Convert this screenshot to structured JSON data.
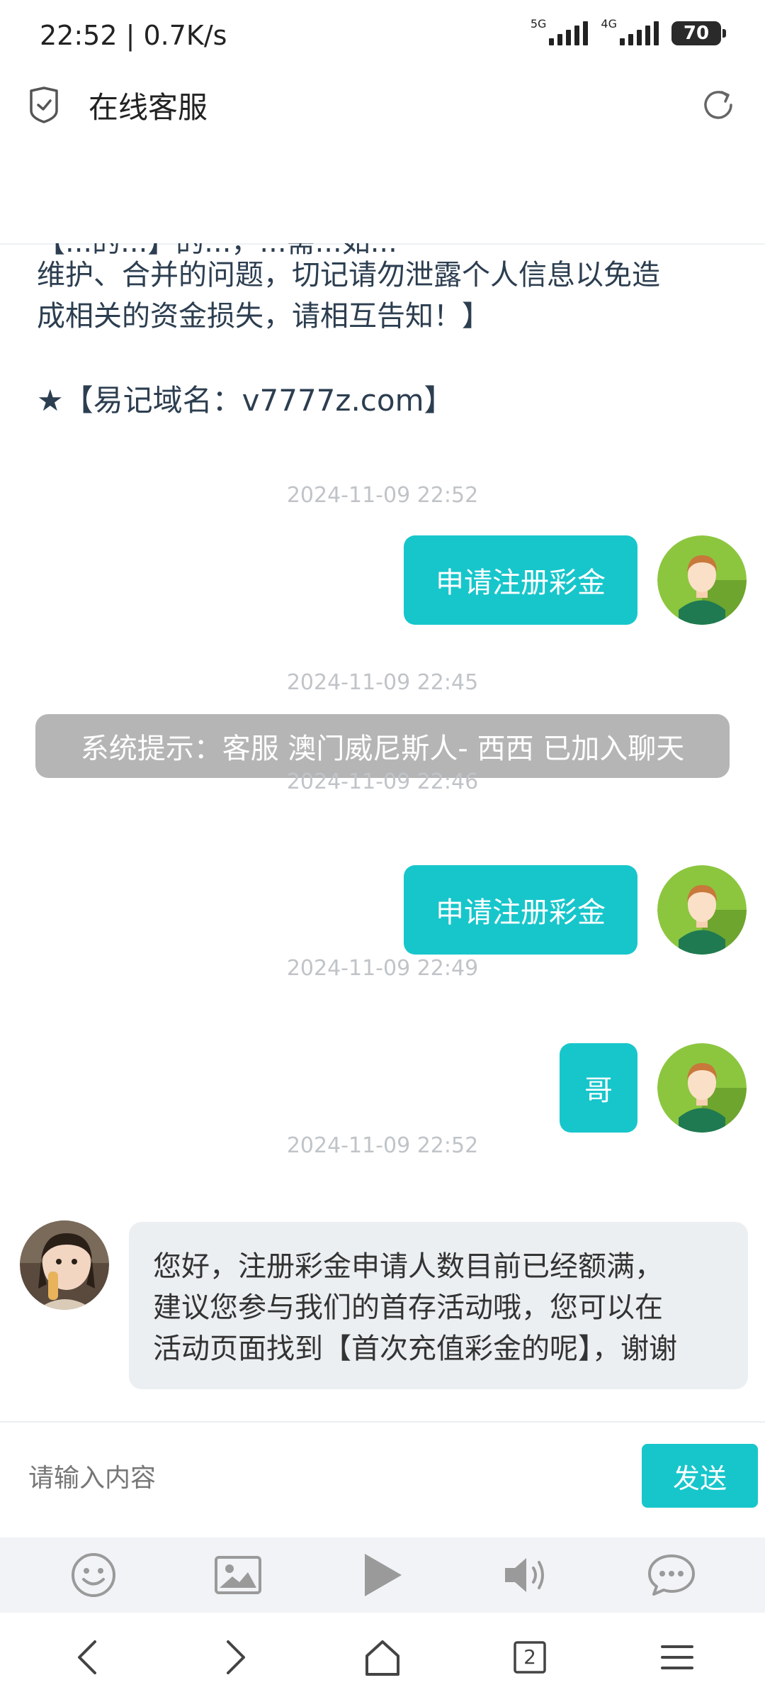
{
  "status_bar": {
    "time": "22:52 | 0.7K/s",
    "net1": "5G",
    "net2": "4G",
    "battery": "70"
  },
  "header": {
    "title": "在线客服"
  },
  "chat": {
    "notice_cut_line": "【...的...】的...，...需...如...",
    "notice_lines": [
      "维护、合并的问题，切记请勿泄露个人信息以免造",
      "成相关的资金损失，请相互告知！】"
    ],
    "domain_line": "★【易记域名：v7777z.com】",
    "messages": [
      {
        "type": "timestamp",
        "text": "2024-11-09 22:52"
      },
      {
        "type": "user",
        "text": "申请注册彩金"
      },
      {
        "type": "timestamp",
        "text": "2024-11-09 22:45"
      },
      {
        "type": "system",
        "text": "系统提示：客服 澳门威尼斯人- 西西 已加入聊天"
      },
      {
        "type": "timestamp",
        "text": "2024-11-09 22:46"
      },
      {
        "type": "user",
        "text": "申请注册彩金"
      },
      {
        "type": "timestamp",
        "text": "2024-11-09 22:49"
      },
      {
        "type": "user",
        "text": "哥"
      },
      {
        "type": "timestamp",
        "text": "2024-11-09 22:52"
      },
      {
        "type": "agent",
        "lines": [
          "您好，注册彩金申请人数目前已经额满，",
          "建议您参与我们的首存活动哦，您可以在",
          "活动页面找到【首次充值彩金的呢】，谢谢"
        ]
      }
    ]
  },
  "input": {
    "placeholder": "请输入内容",
    "send_label": "发送"
  },
  "toolbar": {
    "icons": [
      "emoji-icon",
      "image-icon",
      "play-icon",
      "speaker-icon",
      "chat-bubble-icon"
    ]
  },
  "browser_nav": {
    "tab_count": "2"
  },
  "colors": {
    "accent": "#17c6cb",
    "system_bubble": "#b5b5b5",
    "agent_bubble": "#eceff1",
    "timestamp": "#c0c4c8"
  }
}
